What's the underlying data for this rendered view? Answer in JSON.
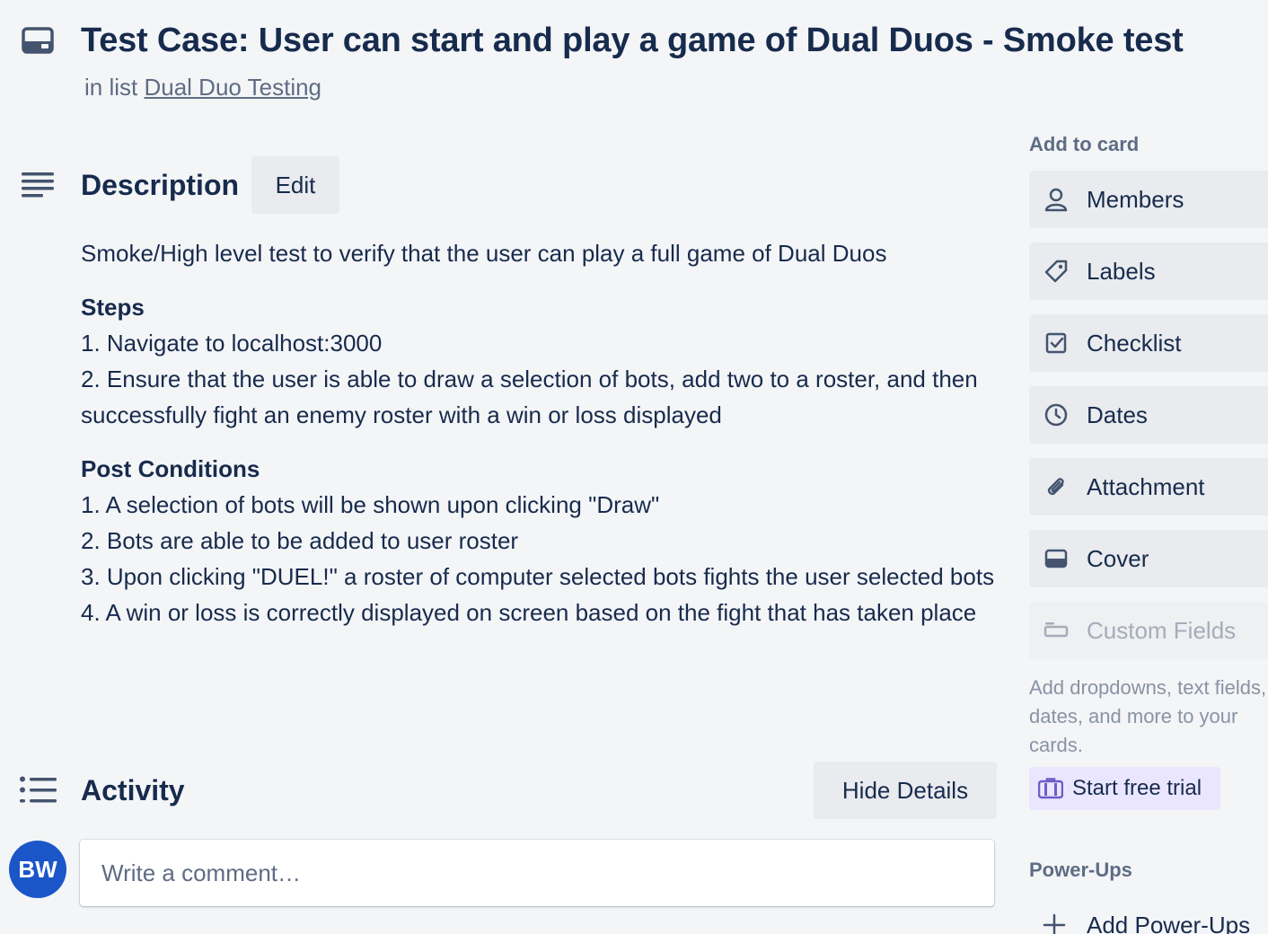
{
  "card": {
    "title": "Test Case: User can start and play a game of Dual Duos - Smoke  test",
    "list_prefix": "in list",
    "list_name": "Dual Duo Testing"
  },
  "description": {
    "heading": "Description",
    "edit_label": "Edit",
    "intro": "Smoke/High level test to verify that the user can play a full game of Dual Duos",
    "steps_heading": "Steps",
    "steps": [
      "1. Navigate to localhost:3000",
      "2. Ensure that the user is able to draw a selection of bots, add two to a roster, and then successfully fight an enemy roster with a win or loss displayed"
    ],
    "post_heading": "Post Conditions",
    "post_conditions": [
      "1. A selection of bots will be shown upon clicking \"Draw\"",
      "2. Bots are able to be added to user roster",
      "3. Upon clicking \"DUEL!\" a roster of computer selected bots fights the user selected bots",
      "4. A win or loss is correctly displayed on screen based on the fight that has taken place"
    ]
  },
  "activity": {
    "heading": "Activity",
    "hide_details_label": "Hide Details",
    "avatar_initials": "BW",
    "comment_placeholder": "Write a comment…"
  },
  "sidebar": {
    "add_to_card_label": "Add to card",
    "items": [
      {
        "label": "Members",
        "icon": "person-icon"
      },
      {
        "label": "Labels",
        "icon": "tag-icon"
      },
      {
        "label": "Checklist",
        "icon": "checkbox-icon"
      },
      {
        "label": "Dates",
        "icon": "clock-icon"
      },
      {
        "label": "Attachment",
        "icon": "paperclip-icon"
      },
      {
        "label": "Cover",
        "icon": "cover-icon"
      },
      {
        "label": "Custom Fields",
        "icon": "custom-fields-icon",
        "disabled": true
      }
    ],
    "custom_fields_help": "Add dropdowns, text fields, dates, and more to your cards.",
    "trial_label": "Start free trial",
    "powerups_label": "Power-Ups",
    "add_powerups_label": "Add Power-Ups"
  },
  "colors": {
    "background": "#f4f5f7",
    "text": "#172b4d",
    "muted": "#5e6c84",
    "button_bg": "#e9ebee",
    "avatar": "#1b56c9",
    "trial_bg": "#eae6ff"
  }
}
